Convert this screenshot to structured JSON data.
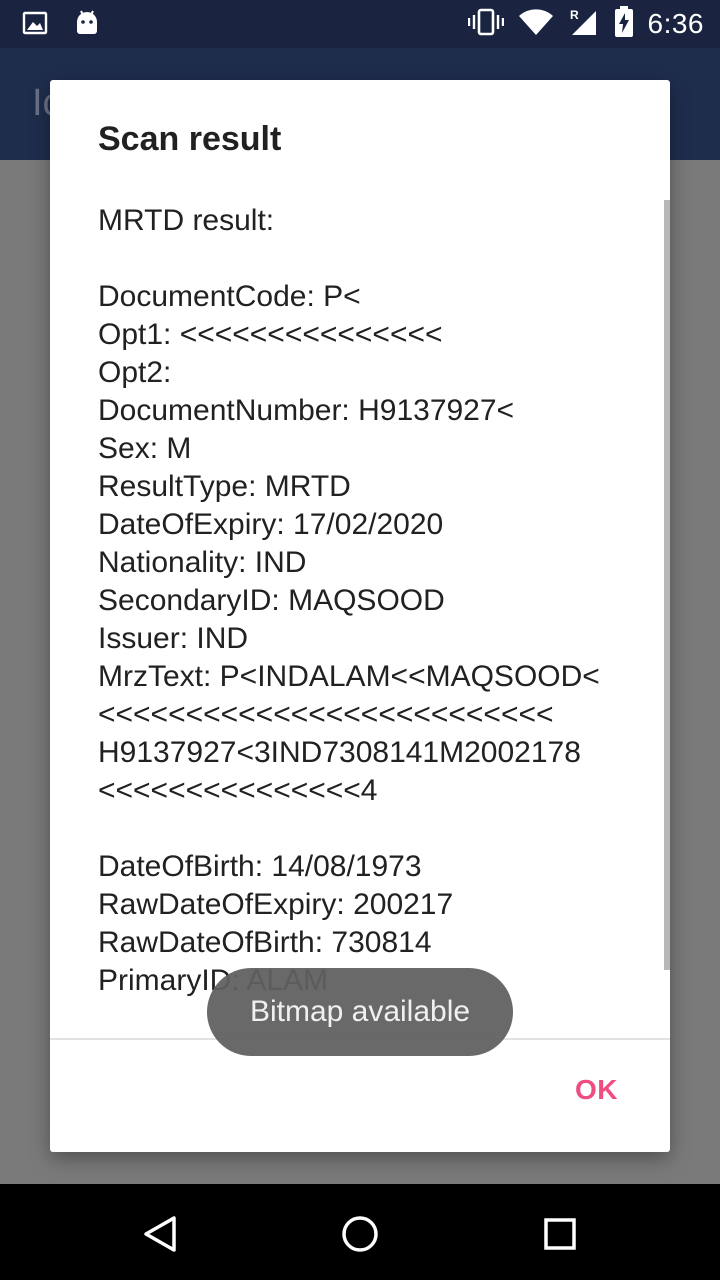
{
  "status_bar": {
    "time": "6:36",
    "left_icons": [
      "image-notification-icon",
      "android-notification-icon"
    ],
    "right_icons": [
      "vibrate-icon",
      "wifi-icon",
      "signal-roaming-icon",
      "battery-charging-icon"
    ]
  },
  "app_bar": {
    "title_partial": "Ic"
  },
  "dialog": {
    "title": "Scan result",
    "body_lines": [
      "MRTD result:",
      "",
      "DocumentCode: P<",
      "Opt1: <<<<<<<<<<<<<<<",
      "Opt2: ",
      "DocumentNumber: H9137927<",
      "Sex: M",
      "ResultType: MRTD",
      "DateOfExpiry: 17/02/2020",
      "Nationality: IND",
      "SecondaryID: MAQSOOD",
      "Issuer: IND",
      "MrzText: P<INDALAM<<MAQSOOD<",
      "<<<<<<<<<<<<<<<<<<<<<<<<<<",
      "H9137927<3IND7308141M2002178",
      "<<<<<<<<<<<<<<<4",
      "",
      "DateOfBirth: 14/08/1973",
      "RawDateOfExpiry: 200217",
      "RawDateOfBirth: 730814",
      "PrimaryID: ALAM"
    ],
    "ok_label": "OK"
  },
  "toast": {
    "message": "Bitmap available"
  },
  "nav_bar": {
    "buttons": [
      "back-button",
      "home-button",
      "recents-button"
    ]
  },
  "colors": {
    "accent": "#ef4c80",
    "status_bar": "#1a2440",
    "scrim": "#7a7a7a"
  }
}
